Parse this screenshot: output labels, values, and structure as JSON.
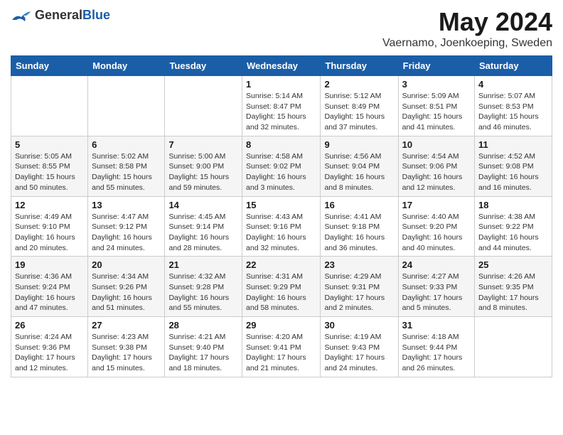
{
  "header": {
    "logo_general": "General",
    "logo_blue": "Blue",
    "month_year": "May 2024",
    "location": "Vaernamo, Joenkoeping, Sweden"
  },
  "weekdays": [
    "Sunday",
    "Monday",
    "Tuesday",
    "Wednesday",
    "Thursday",
    "Friday",
    "Saturday"
  ],
  "weeks": [
    [
      {
        "day": "",
        "info": ""
      },
      {
        "day": "",
        "info": ""
      },
      {
        "day": "",
        "info": ""
      },
      {
        "day": "1",
        "info": "Sunrise: 5:14 AM\nSunset: 8:47 PM\nDaylight: 15 hours\nand 32 minutes."
      },
      {
        "day": "2",
        "info": "Sunrise: 5:12 AM\nSunset: 8:49 PM\nDaylight: 15 hours\nand 37 minutes."
      },
      {
        "day": "3",
        "info": "Sunrise: 5:09 AM\nSunset: 8:51 PM\nDaylight: 15 hours\nand 41 minutes."
      },
      {
        "day": "4",
        "info": "Sunrise: 5:07 AM\nSunset: 8:53 PM\nDaylight: 15 hours\nand 46 minutes."
      }
    ],
    [
      {
        "day": "5",
        "info": "Sunrise: 5:05 AM\nSunset: 8:55 PM\nDaylight: 15 hours\nand 50 minutes."
      },
      {
        "day": "6",
        "info": "Sunrise: 5:02 AM\nSunset: 8:58 PM\nDaylight: 15 hours\nand 55 minutes."
      },
      {
        "day": "7",
        "info": "Sunrise: 5:00 AM\nSunset: 9:00 PM\nDaylight: 15 hours\nand 59 minutes."
      },
      {
        "day": "8",
        "info": "Sunrise: 4:58 AM\nSunset: 9:02 PM\nDaylight: 16 hours\nand 3 minutes."
      },
      {
        "day": "9",
        "info": "Sunrise: 4:56 AM\nSunset: 9:04 PM\nDaylight: 16 hours\nand 8 minutes."
      },
      {
        "day": "10",
        "info": "Sunrise: 4:54 AM\nSunset: 9:06 PM\nDaylight: 16 hours\nand 12 minutes."
      },
      {
        "day": "11",
        "info": "Sunrise: 4:52 AM\nSunset: 9:08 PM\nDaylight: 16 hours\nand 16 minutes."
      }
    ],
    [
      {
        "day": "12",
        "info": "Sunrise: 4:49 AM\nSunset: 9:10 PM\nDaylight: 16 hours\nand 20 minutes."
      },
      {
        "day": "13",
        "info": "Sunrise: 4:47 AM\nSunset: 9:12 PM\nDaylight: 16 hours\nand 24 minutes."
      },
      {
        "day": "14",
        "info": "Sunrise: 4:45 AM\nSunset: 9:14 PM\nDaylight: 16 hours\nand 28 minutes."
      },
      {
        "day": "15",
        "info": "Sunrise: 4:43 AM\nSunset: 9:16 PM\nDaylight: 16 hours\nand 32 minutes."
      },
      {
        "day": "16",
        "info": "Sunrise: 4:41 AM\nSunset: 9:18 PM\nDaylight: 16 hours\nand 36 minutes."
      },
      {
        "day": "17",
        "info": "Sunrise: 4:40 AM\nSunset: 9:20 PM\nDaylight: 16 hours\nand 40 minutes."
      },
      {
        "day": "18",
        "info": "Sunrise: 4:38 AM\nSunset: 9:22 PM\nDaylight: 16 hours\nand 44 minutes."
      }
    ],
    [
      {
        "day": "19",
        "info": "Sunrise: 4:36 AM\nSunset: 9:24 PM\nDaylight: 16 hours\nand 47 minutes."
      },
      {
        "day": "20",
        "info": "Sunrise: 4:34 AM\nSunset: 9:26 PM\nDaylight: 16 hours\nand 51 minutes."
      },
      {
        "day": "21",
        "info": "Sunrise: 4:32 AM\nSunset: 9:28 PM\nDaylight: 16 hours\nand 55 minutes."
      },
      {
        "day": "22",
        "info": "Sunrise: 4:31 AM\nSunset: 9:29 PM\nDaylight: 16 hours\nand 58 minutes."
      },
      {
        "day": "23",
        "info": "Sunrise: 4:29 AM\nSunset: 9:31 PM\nDaylight: 17 hours\nand 2 minutes."
      },
      {
        "day": "24",
        "info": "Sunrise: 4:27 AM\nSunset: 9:33 PM\nDaylight: 17 hours\nand 5 minutes."
      },
      {
        "day": "25",
        "info": "Sunrise: 4:26 AM\nSunset: 9:35 PM\nDaylight: 17 hours\nand 8 minutes."
      }
    ],
    [
      {
        "day": "26",
        "info": "Sunrise: 4:24 AM\nSunset: 9:36 PM\nDaylight: 17 hours\nand 12 minutes."
      },
      {
        "day": "27",
        "info": "Sunrise: 4:23 AM\nSunset: 9:38 PM\nDaylight: 17 hours\nand 15 minutes."
      },
      {
        "day": "28",
        "info": "Sunrise: 4:21 AM\nSunset: 9:40 PM\nDaylight: 17 hours\nand 18 minutes."
      },
      {
        "day": "29",
        "info": "Sunrise: 4:20 AM\nSunset: 9:41 PM\nDaylight: 17 hours\nand 21 minutes."
      },
      {
        "day": "30",
        "info": "Sunrise: 4:19 AM\nSunset: 9:43 PM\nDaylight: 17 hours\nand 24 minutes."
      },
      {
        "day": "31",
        "info": "Sunrise: 4:18 AM\nSunset: 9:44 PM\nDaylight: 17 hours\nand 26 minutes."
      },
      {
        "day": "",
        "info": ""
      }
    ]
  ]
}
